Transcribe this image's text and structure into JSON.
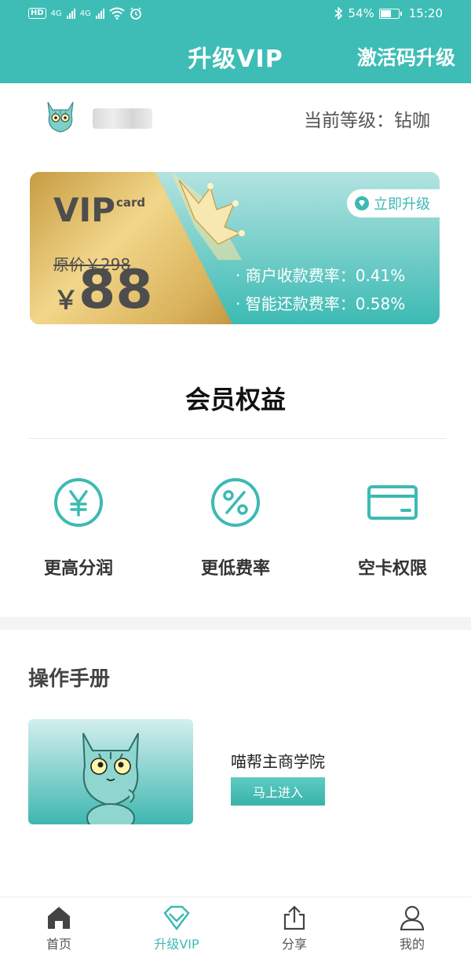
{
  "status_bar": {
    "hd": "HD",
    "net1": "4G",
    "net2": "4G",
    "battery_pct": "54%",
    "time": "15:20"
  },
  "header": {
    "title": "升级VIP",
    "action": "激活码升级"
  },
  "user": {
    "level_text": "当前等级：钻咖"
  },
  "vip_card": {
    "logo": "VIP",
    "logo_sub": "card",
    "original_price": "原价￥298",
    "price_symbol": "￥",
    "price": "88",
    "upgrade_label": "立即升级",
    "rates": [
      "· 商户收款费率：0.41%",
      "· 智能还款费率：0.58%"
    ]
  },
  "benefits": {
    "title": "会员权益",
    "items": [
      {
        "label": "更高分润",
        "icon": "yen-circle-icon"
      },
      {
        "label": "更低费率",
        "icon": "percent-circle-icon"
      },
      {
        "label": "空卡权限",
        "icon": "card-icon"
      }
    ]
  },
  "manual": {
    "title": "操作手册",
    "academy": "喵帮主商学院",
    "enter_label": "马上进入"
  },
  "tabs": [
    {
      "label": "首页",
      "icon": "home-icon"
    },
    {
      "label": "升级VIP",
      "icon": "diamond-icon",
      "active": true
    },
    {
      "label": "分享",
      "icon": "share-icon"
    },
    {
      "label": "我的",
      "icon": "user-icon"
    }
  ],
  "colors": {
    "primary": "#3dbdb5",
    "gold": "#e8c572",
    "text_dark": "#333333"
  }
}
